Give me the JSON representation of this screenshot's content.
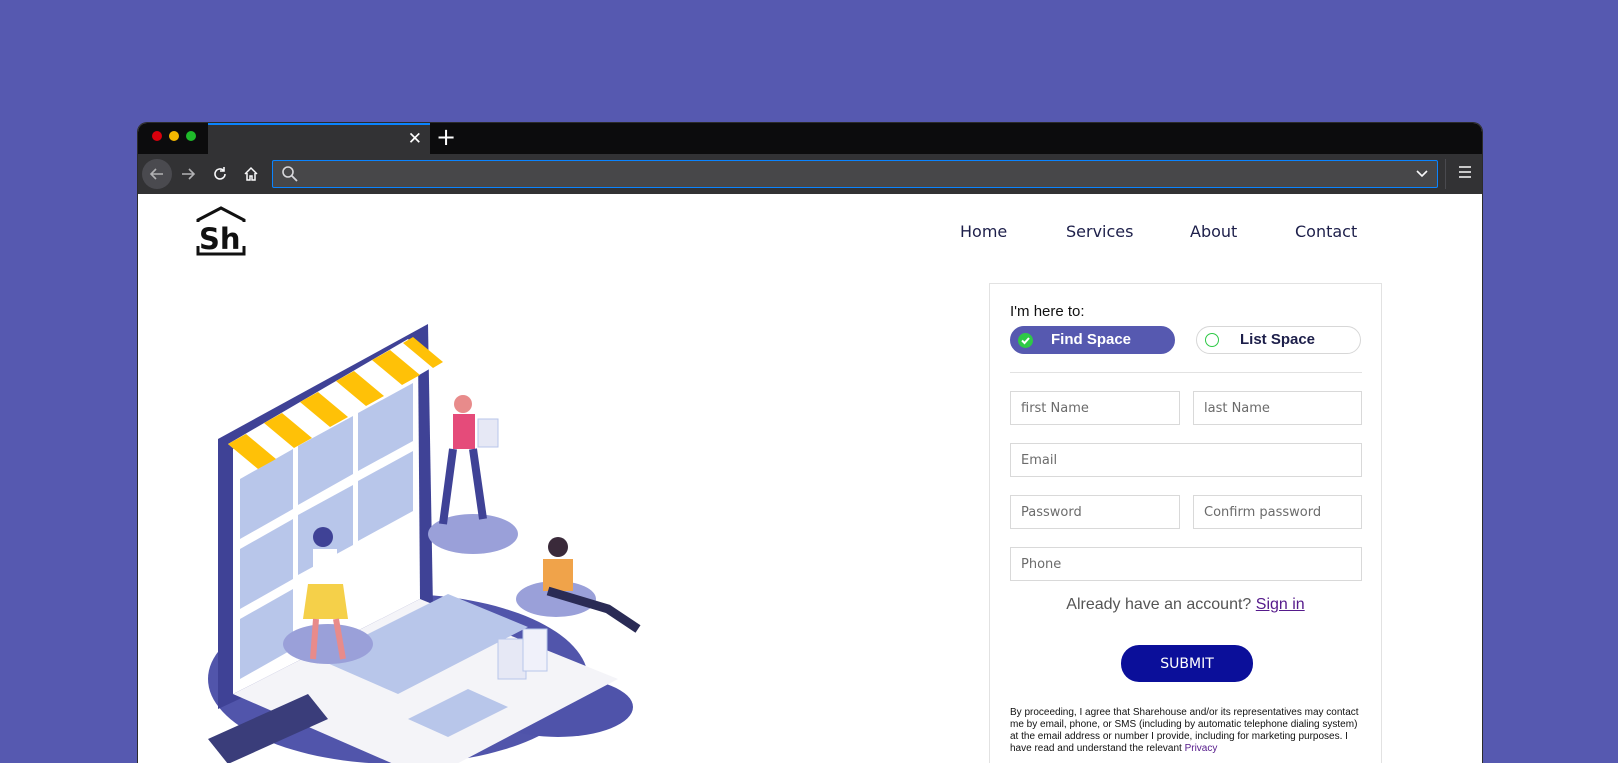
{
  "browser": {
    "tab_close": "✕",
    "new_tab": "+",
    "url_value": ""
  },
  "site": {
    "logo_text": "Sh",
    "nav": [
      "Home",
      "Services",
      "About",
      "Contact"
    ]
  },
  "form": {
    "intro": "I'm here to:",
    "options": [
      {
        "label": "Find Space",
        "selected": true
      },
      {
        "label": "List Space",
        "selected": false
      }
    ],
    "placeholders": {
      "first_name": "first Name",
      "last_name": "last Name",
      "email": "Email",
      "password": "Password",
      "confirm_password": "Confirm password",
      "phone": "Phone"
    },
    "signin_prompt": "Already have an account?",
    "signin_link": "Sign in",
    "submit": "SUBMIT",
    "legal_text": "By proceeding, I agree that Sharehouse and/or its representatives may contact me by email, phone, or SMS (including by automatic telephone dialing system) at the email address or number I provide, including for marketing purposes. I have read and understand the relevant",
    "legal_link": "Privacy"
  },
  "colors": {
    "background": "#5659b0",
    "accent": "#5659b0",
    "submit": "#0b0f9a",
    "check": "#2ec946"
  },
  "icons": [
    "back-arrow-icon",
    "forward-arrow-icon",
    "reload-icon",
    "home-icon",
    "search-icon",
    "chevron-down-icon",
    "hamburger-menu-icon",
    "check-icon"
  ]
}
